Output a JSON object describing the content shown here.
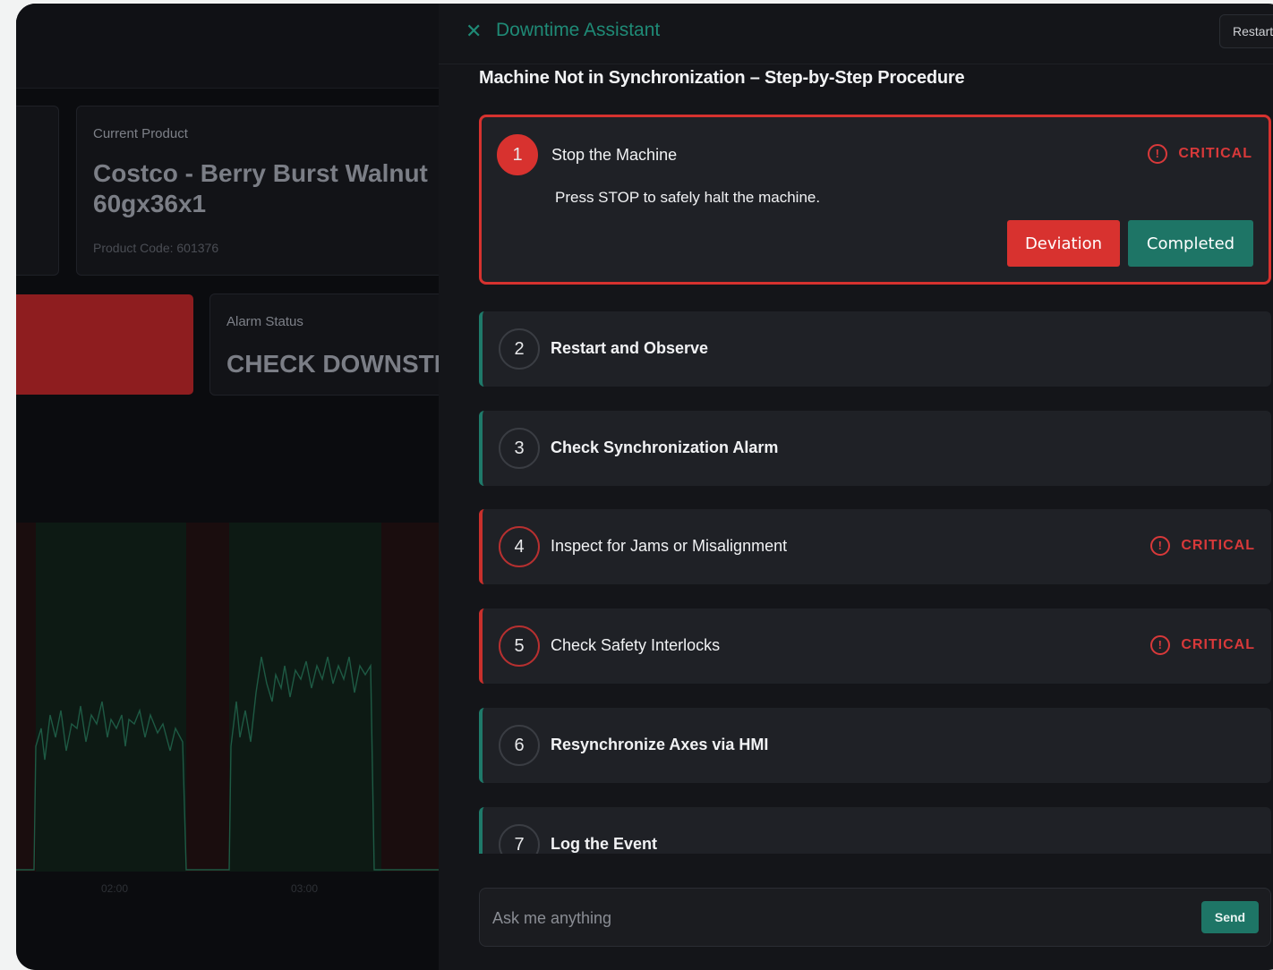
{
  "dashboard": {
    "current_product_label": "Current Product",
    "product_name": "Costco - Berry Burst Walnut 60gx36x1",
    "product_code_label": "Product Code:",
    "product_code": "601376",
    "alarm_status_label": "Alarm Status",
    "alarm_status_value": "CHECK DOWNSTR",
    "chart_ticks": [
      "02:00",
      "03:00"
    ]
  },
  "panel": {
    "title": "Downtime Assistant",
    "restart_label": "Restart",
    "procedure_title": "Machine Not in Synchronization – Step-by-Step Procedure",
    "critical_label": "CRITICAL",
    "steps": [
      {
        "num": "1",
        "label": "Stop the Machine",
        "critical": true,
        "description": "Press STOP to safely halt the machine."
      },
      {
        "num": "2",
        "label": "Restart and Observe",
        "critical": false
      },
      {
        "num": "3",
        "label": "Check Synchronization Alarm",
        "critical": false
      },
      {
        "num": "4",
        "label": "Inspect for Jams or Misalignment",
        "critical": true
      },
      {
        "num": "5",
        "label": "Check Safety Interlocks",
        "critical": true
      },
      {
        "num": "6",
        "label": "Resynchronize Axes via HMI",
        "critical": false
      },
      {
        "num": "7",
        "label": "Log the Event",
        "critical": false
      }
    ],
    "deviation_label": "Deviation",
    "completed_label": "Completed",
    "chat_placeholder": "Ask me anything",
    "send_label": "Send"
  },
  "colors": {
    "accent": "#1f8a76",
    "critical": "#d8393a",
    "panel_bg": "#141519",
    "step_bg": "#1f2126"
  }
}
